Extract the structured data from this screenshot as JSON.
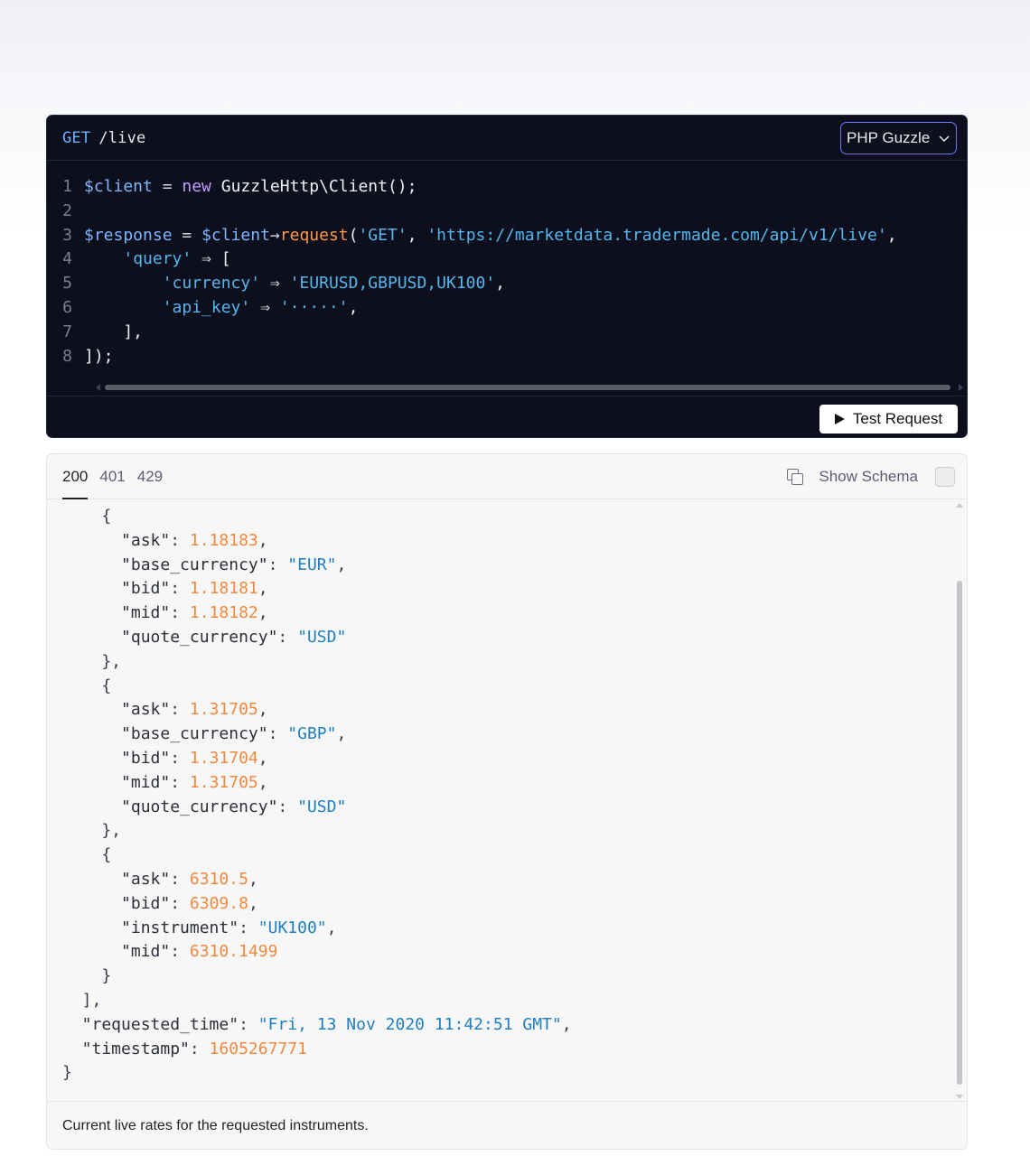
{
  "request": {
    "method": "GET",
    "path": "/live",
    "language": "PHP Guzzle",
    "test_label": "Test Request",
    "code_lines": [
      {
        "n": "1",
        "tokens": [
          {
            "t": "$client",
            "c": "var"
          },
          {
            "t": " = ",
            "c": "op"
          },
          {
            "t": "new",
            "c": "kw"
          },
          {
            "t": " GuzzleHttp\\Client();",
            "c": "plain"
          }
        ]
      },
      {
        "n": "2",
        "tokens": []
      },
      {
        "n": "3",
        "tokens": [
          {
            "t": "$response",
            "c": "var"
          },
          {
            "t": " = ",
            "c": "op"
          },
          {
            "t": "$client",
            "c": "var"
          },
          {
            "t": "→",
            "c": "op"
          },
          {
            "t": "request",
            "c": "fn"
          },
          {
            "t": "(",
            "c": "plain"
          },
          {
            "t": "'GET'",
            "c": "str"
          },
          {
            "t": ", ",
            "c": "plain"
          },
          {
            "t": "'https://marketdata.tradermade.com/api/v1/live'",
            "c": "str"
          },
          {
            "t": ",",
            "c": "plain"
          }
        ]
      },
      {
        "n": "4",
        "tokens": [
          {
            "t": "    ",
            "c": "plain"
          },
          {
            "t": "'query'",
            "c": "str"
          },
          {
            "t": " ⇒ ",
            "c": "op"
          },
          {
            "t": "[",
            "c": "plain"
          }
        ]
      },
      {
        "n": "5",
        "tokens": [
          {
            "t": "        ",
            "c": "plain"
          },
          {
            "t": "'currency'",
            "c": "str"
          },
          {
            "t": " ⇒ ",
            "c": "op"
          },
          {
            "t": "'EURUSD,GBPUSD,UK100'",
            "c": "str"
          },
          {
            "t": ",",
            "c": "plain"
          }
        ]
      },
      {
        "n": "6",
        "tokens": [
          {
            "t": "        ",
            "c": "plain"
          },
          {
            "t": "'api_key'",
            "c": "str"
          },
          {
            "t": " ⇒ ",
            "c": "op"
          },
          {
            "t": "'·····'",
            "c": "str"
          },
          {
            "t": ",",
            "c": "plain"
          }
        ]
      },
      {
        "n": "7",
        "tokens": [
          {
            "t": "    ],",
            "c": "plain"
          }
        ]
      },
      {
        "n": "8",
        "tokens": [
          {
            "t": "]);",
            "c": "plain"
          }
        ]
      }
    ]
  },
  "response": {
    "tabs": [
      {
        "label": "200",
        "active": true
      },
      {
        "label": "401",
        "active": false
      },
      {
        "label": "429",
        "active": false
      }
    ],
    "schema_label": "Show Schema",
    "description": "Current live rates for the requested instruments.",
    "json_lines": [
      [
        {
          "t": "    {",
          "c": "p"
        }
      ],
      [
        {
          "t": "      \"ask\"",
          "c": "key"
        },
        {
          "t": ": ",
          "c": "p"
        },
        {
          "t": "1.18183",
          "c": "num"
        },
        {
          "t": ",",
          "c": "p"
        }
      ],
      [
        {
          "t": "      \"base_currency\"",
          "c": "key"
        },
        {
          "t": ": ",
          "c": "p"
        },
        {
          "t": "\"EUR\"",
          "c": "str"
        },
        {
          "t": ",",
          "c": "p"
        }
      ],
      [
        {
          "t": "      \"bid\"",
          "c": "key"
        },
        {
          "t": ": ",
          "c": "p"
        },
        {
          "t": "1.18181",
          "c": "num"
        },
        {
          "t": ",",
          "c": "p"
        }
      ],
      [
        {
          "t": "      \"mid\"",
          "c": "key"
        },
        {
          "t": ": ",
          "c": "p"
        },
        {
          "t": "1.18182",
          "c": "num"
        },
        {
          "t": ",",
          "c": "p"
        }
      ],
      [
        {
          "t": "      \"quote_currency\"",
          "c": "key"
        },
        {
          "t": ": ",
          "c": "p"
        },
        {
          "t": "\"USD\"",
          "c": "str"
        }
      ],
      [
        {
          "t": "    },",
          "c": "p"
        }
      ],
      [
        {
          "t": "    {",
          "c": "p"
        }
      ],
      [
        {
          "t": "      \"ask\"",
          "c": "key"
        },
        {
          "t": ": ",
          "c": "p"
        },
        {
          "t": "1.31705",
          "c": "num"
        },
        {
          "t": ",",
          "c": "p"
        }
      ],
      [
        {
          "t": "      \"base_currency\"",
          "c": "key"
        },
        {
          "t": ": ",
          "c": "p"
        },
        {
          "t": "\"GBP\"",
          "c": "str"
        },
        {
          "t": ",",
          "c": "p"
        }
      ],
      [
        {
          "t": "      \"bid\"",
          "c": "key"
        },
        {
          "t": ": ",
          "c": "p"
        },
        {
          "t": "1.31704",
          "c": "num"
        },
        {
          "t": ",",
          "c": "p"
        }
      ],
      [
        {
          "t": "      \"mid\"",
          "c": "key"
        },
        {
          "t": ": ",
          "c": "p"
        },
        {
          "t": "1.31705",
          "c": "num"
        },
        {
          "t": ",",
          "c": "p"
        }
      ],
      [
        {
          "t": "      \"quote_currency\"",
          "c": "key"
        },
        {
          "t": ": ",
          "c": "p"
        },
        {
          "t": "\"USD\"",
          "c": "str"
        }
      ],
      [
        {
          "t": "    },",
          "c": "p"
        }
      ],
      [
        {
          "t": "    {",
          "c": "p"
        }
      ],
      [
        {
          "t": "      \"ask\"",
          "c": "key"
        },
        {
          "t": ": ",
          "c": "p"
        },
        {
          "t": "6310.5",
          "c": "num"
        },
        {
          "t": ",",
          "c": "p"
        }
      ],
      [
        {
          "t": "      \"bid\"",
          "c": "key"
        },
        {
          "t": ": ",
          "c": "p"
        },
        {
          "t": "6309.8",
          "c": "num"
        },
        {
          "t": ",",
          "c": "p"
        }
      ],
      [
        {
          "t": "      \"instrument\"",
          "c": "key"
        },
        {
          "t": ": ",
          "c": "p"
        },
        {
          "t": "\"UK100\"",
          "c": "str"
        },
        {
          "t": ",",
          "c": "p"
        }
      ],
      [
        {
          "t": "      \"mid\"",
          "c": "key"
        },
        {
          "t": ": ",
          "c": "p"
        },
        {
          "t": "6310.1499",
          "c": "num"
        }
      ],
      [
        {
          "t": "    }",
          "c": "p"
        }
      ],
      [
        {
          "t": "  ],",
          "c": "p"
        }
      ],
      [
        {
          "t": "  \"requested_time\"",
          "c": "key"
        },
        {
          "t": ": ",
          "c": "p"
        },
        {
          "t": "\"Fri, 13 Nov 2020 11:42:51 GMT\"",
          "c": "str"
        },
        {
          "t": ",",
          "c": "p"
        }
      ],
      [
        {
          "t": "  \"timestamp\"",
          "c": "key"
        },
        {
          "t": ": ",
          "c": "p"
        },
        {
          "t": "1605267771",
          "c": "num"
        }
      ],
      [
        {
          "t": "}",
          "c": "p"
        }
      ]
    ]
  }
}
